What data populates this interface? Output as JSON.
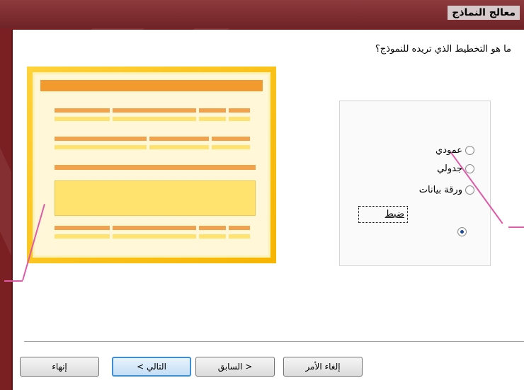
{
  "window": {
    "title": "معالج النماذج"
  },
  "wizard": {
    "question": "ما هو التخطيط الذي تريده للنموذج؟",
    "options": [
      {
        "label": "عمودي",
        "selected": false
      },
      {
        "label": "جدولي",
        "selected": false
      },
      {
        "label": "ورقة بيانات",
        "selected": false
      },
      {
        "label": "ضبط",
        "selected": true
      }
    ]
  },
  "buttons": {
    "cancel": "إلغاء الأمر",
    "back": "< السابق",
    "next": "التالي >",
    "finish": "إنهاء"
  },
  "colors": {
    "accent": "#f7b400",
    "preview_bar": "#f29a2e",
    "annotation": "#e05aa8",
    "backdrop": "#7a1f22"
  }
}
